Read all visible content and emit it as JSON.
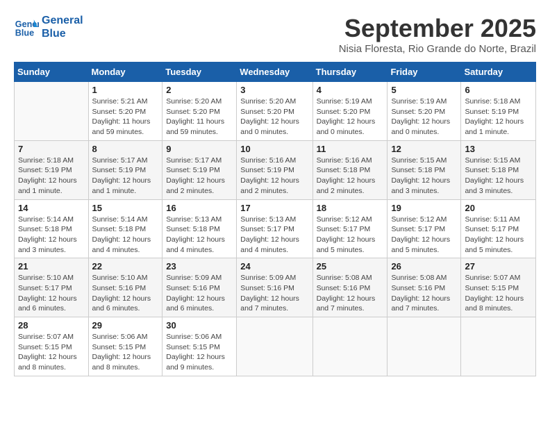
{
  "header": {
    "logo_line1": "General",
    "logo_line2": "Blue",
    "month_title": "September 2025",
    "location": "Nisia Floresta, Rio Grande do Norte, Brazil"
  },
  "weekdays": [
    "Sunday",
    "Monday",
    "Tuesday",
    "Wednesday",
    "Thursday",
    "Friday",
    "Saturday"
  ],
  "weeks": [
    [
      {
        "day": "",
        "info": ""
      },
      {
        "day": "1",
        "info": "Sunrise: 5:21 AM\nSunset: 5:20 PM\nDaylight: 11 hours\nand 59 minutes."
      },
      {
        "day": "2",
        "info": "Sunrise: 5:20 AM\nSunset: 5:20 PM\nDaylight: 11 hours\nand 59 minutes."
      },
      {
        "day": "3",
        "info": "Sunrise: 5:20 AM\nSunset: 5:20 PM\nDaylight: 12 hours\nand 0 minutes."
      },
      {
        "day": "4",
        "info": "Sunrise: 5:19 AM\nSunset: 5:20 PM\nDaylight: 12 hours\nand 0 minutes."
      },
      {
        "day": "5",
        "info": "Sunrise: 5:19 AM\nSunset: 5:20 PM\nDaylight: 12 hours\nand 0 minutes."
      },
      {
        "day": "6",
        "info": "Sunrise: 5:18 AM\nSunset: 5:19 PM\nDaylight: 12 hours\nand 1 minute."
      }
    ],
    [
      {
        "day": "7",
        "info": "Sunrise: 5:18 AM\nSunset: 5:19 PM\nDaylight: 12 hours\nand 1 minute."
      },
      {
        "day": "8",
        "info": "Sunrise: 5:17 AM\nSunset: 5:19 PM\nDaylight: 12 hours\nand 1 minute."
      },
      {
        "day": "9",
        "info": "Sunrise: 5:17 AM\nSunset: 5:19 PM\nDaylight: 12 hours\nand 2 minutes."
      },
      {
        "day": "10",
        "info": "Sunrise: 5:16 AM\nSunset: 5:19 PM\nDaylight: 12 hours\nand 2 minutes."
      },
      {
        "day": "11",
        "info": "Sunrise: 5:16 AM\nSunset: 5:18 PM\nDaylight: 12 hours\nand 2 minutes."
      },
      {
        "day": "12",
        "info": "Sunrise: 5:15 AM\nSunset: 5:18 PM\nDaylight: 12 hours\nand 3 minutes."
      },
      {
        "day": "13",
        "info": "Sunrise: 5:15 AM\nSunset: 5:18 PM\nDaylight: 12 hours\nand 3 minutes."
      }
    ],
    [
      {
        "day": "14",
        "info": "Sunrise: 5:14 AM\nSunset: 5:18 PM\nDaylight: 12 hours\nand 3 minutes."
      },
      {
        "day": "15",
        "info": "Sunrise: 5:14 AM\nSunset: 5:18 PM\nDaylight: 12 hours\nand 4 minutes."
      },
      {
        "day": "16",
        "info": "Sunrise: 5:13 AM\nSunset: 5:18 PM\nDaylight: 12 hours\nand 4 minutes."
      },
      {
        "day": "17",
        "info": "Sunrise: 5:13 AM\nSunset: 5:17 PM\nDaylight: 12 hours\nand 4 minutes."
      },
      {
        "day": "18",
        "info": "Sunrise: 5:12 AM\nSunset: 5:17 PM\nDaylight: 12 hours\nand 5 minutes."
      },
      {
        "day": "19",
        "info": "Sunrise: 5:12 AM\nSunset: 5:17 PM\nDaylight: 12 hours\nand 5 minutes."
      },
      {
        "day": "20",
        "info": "Sunrise: 5:11 AM\nSunset: 5:17 PM\nDaylight: 12 hours\nand 5 minutes."
      }
    ],
    [
      {
        "day": "21",
        "info": "Sunrise: 5:10 AM\nSunset: 5:17 PM\nDaylight: 12 hours\nand 6 minutes."
      },
      {
        "day": "22",
        "info": "Sunrise: 5:10 AM\nSunset: 5:16 PM\nDaylight: 12 hours\nand 6 minutes."
      },
      {
        "day": "23",
        "info": "Sunrise: 5:09 AM\nSunset: 5:16 PM\nDaylight: 12 hours\nand 6 minutes."
      },
      {
        "day": "24",
        "info": "Sunrise: 5:09 AM\nSunset: 5:16 PM\nDaylight: 12 hours\nand 7 minutes."
      },
      {
        "day": "25",
        "info": "Sunrise: 5:08 AM\nSunset: 5:16 PM\nDaylight: 12 hours\nand 7 minutes."
      },
      {
        "day": "26",
        "info": "Sunrise: 5:08 AM\nSunset: 5:16 PM\nDaylight: 12 hours\nand 7 minutes."
      },
      {
        "day": "27",
        "info": "Sunrise: 5:07 AM\nSunset: 5:15 PM\nDaylight: 12 hours\nand 8 minutes."
      }
    ],
    [
      {
        "day": "28",
        "info": "Sunrise: 5:07 AM\nSunset: 5:15 PM\nDaylight: 12 hours\nand 8 minutes."
      },
      {
        "day": "29",
        "info": "Sunrise: 5:06 AM\nSunset: 5:15 PM\nDaylight: 12 hours\nand 8 minutes."
      },
      {
        "day": "30",
        "info": "Sunrise: 5:06 AM\nSunset: 5:15 PM\nDaylight: 12 hours\nand 9 minutes."
      },
      {
        "day": "",
        "info": ""
      },
      {
        "day": "",
        "info": ""
      },
      {
        "day": "",
        "info": ""
      },
      {
        "day": "",
        "info": ""
      }
    ]
  ]
}
